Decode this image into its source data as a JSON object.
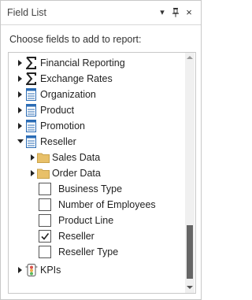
{
  "window": {
    "title": "Field List",
    "dropdown_icon": "▾",
    "pin_icon": "pin",
    "close_icon": "×"
  },
  "instruction": "Choose fields to add to report:",
  "tree": {
    "items": [
      {
        "label": "Financial Reporting",
        "icon": "sigma-icon",
        "expanded": false
      },
      {
        "label": "Exchange Rates",
        "icon": "sigma-icon",
        "expanded": false
      },
      {
        "label": "Organization",
        "icon": "table-icon",
        "expanded": false
      },
      {
        "label": "Product",
        "icon": "table-icon",
        "expanded": false
      },
      {
        "label": "Promotion",
        "icon": "table-icon",
        "expanded": false
      },
      {
        "label": "Reseller",
        "icon": "table-icon",
        "expanded": true
      },
      {
        "label": "Sales Data",
        "icon": "folder-icon",
        "expanded": false
      },
      {
        "label": "Order Data",
        "icon": "folder-icon",
        "expanded": false
      },
      {
        "label": "Business Type",
        "checked": false
      },
      {
        "label": "Number of Employees",
        "checked": false
      },
      {
        "label": "Product Line",
        "checked": false
      },
      {
        "label": "Reseller",
        "checked": true
      },
      {
        "label": "Reseller Type",
        "checked": false
      },
      {
        "label": "KPIs",
        "icon": "kpi-icon",
        "expanded": false
      }
    ]
  },
  "colors": {
    "table_icon_blue": "#2b6cb5",
    "folder_yellow": "#e8c069",
    "kpi_red": "#d9534f",
    "scroll_thumb": "#666666"
  }
}
